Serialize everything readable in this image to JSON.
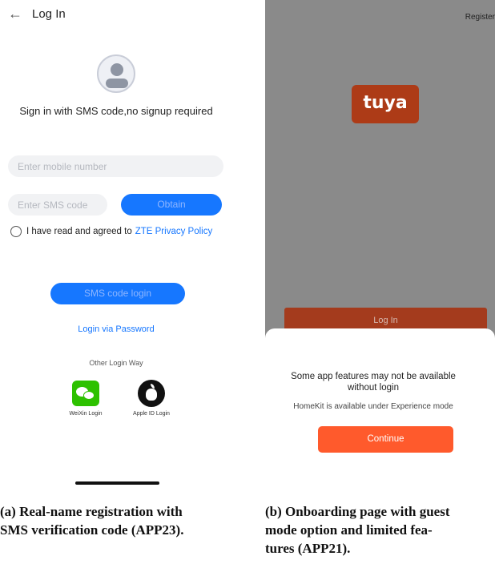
{
  "panel_a": {
    "header": {
      "back_icon": "arrow-left-icon",
      "title": "Log In"
    },
    "avatar_icon": "user-avatar-icon",
    "subtitle": "Sign in with SMS code,no signup required",
    "mobile_input": {
      "placeholder": "Enter mobile number",
      "value": ""
    },
    "sms_input": {
      "placeholder": "Enter SMS code",
      "value": ""
    },
    "obtain_label": "Obtain",
    "agreement": {
      "checked": false,
      "text": "I have read and agreed to",
      "link": "ZTE Privacy Policy"
    },
    "sms_login_label": "SMS code login",
    "password_link": "Login via Password",
    "other_login_label": "Other Login Way",
    "weixin_label": "WeiXin Login",
    "apple_label": "Apple ID Login",
    "colors": {
      "accent": "#1677ff",
      "input_bg": "#f1f2f4",
      "wechat": "#2dc100"
    }
  },
  "panel_b": {
    "register_label": "Register",
    "logo_text": "tuya",
    "login_label": "Log In",
    "limited_message": "Some app features may not be available without login",
    "homekit_message": "HomeKit is available under Experience mode",
    "continue_label": "Continue",
    "colors": {
      "overlay": "#8a8a8a",
      "brand": "#ad3b17",
      "continue": "#ff5a2c"
    }
  },
  "captions": {
    "a_line1": "(a) Real-name registration with",
    "a_line2": "SMS verification code (APP23).",
    "b_line1": "(b) Onboarding page with guest",
    "b_line2": "mode option and limited fea-",
    "b_line3": "tures (APP21)."
  }
}
